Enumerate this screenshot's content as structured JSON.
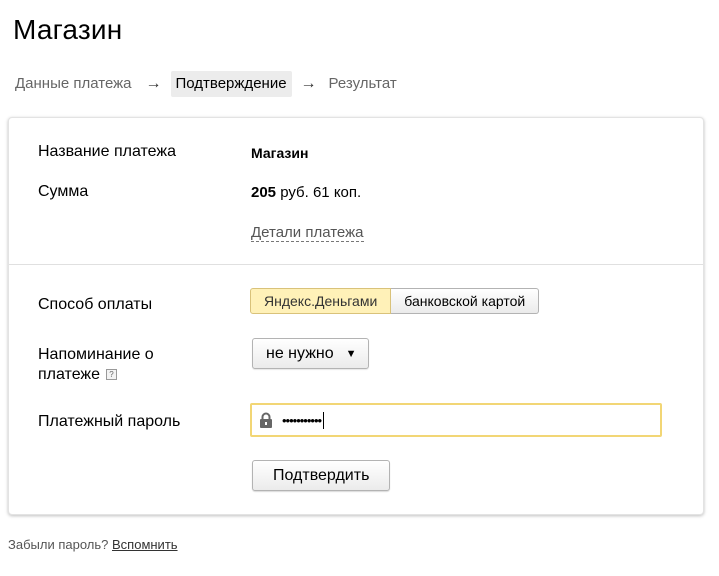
{
  "page": {
    "title": "Магазин"
  },
  "steps": [
    {
      "label": "Данные платежа"
    },
    {
      "label": "Подтверждение"
    },
    {
      "label": "Результат"
    }
  ],
  "steps_arrow": "→",
  "summary": {
    "name_label": "Название платежа",
    "name_value": "Магазин",
    "amount_label": "Сумма",
    "amount_rub": "205",
    "amount_rest": " руб. 61 коп.",
    "details_link": "Детали платежа"
  },
  "form": {
    "method_label": "Способ оплаты",
    "method_options": [
      "Яндекс.Деньгами",
      "банковской картой"
    ],
    "method_selected": "Яндекс.Деньгами",
    "reminder_label_line1": "Напоминание о",
    "reminder_label_line2": "платеже",
    "reminder_value": "не нужно",
    "password_label": "Платежный пароль",
    "password_value": "•••••••••••",
    "submit_label": "Подтвердить"
  },
  "footer": {
    "text": "Забыли пароль?",
    "link": "Вспомнить"
  },
  "colors": {
    "selected_option_bg": "#fff1b8",
    "password_focus_border": "#f2d675"
  },
  "icons": [
    "lock-icon",
    "help-icon",
    "chevron-down-icon",
    "arrow-right-icon"
  ]
}
